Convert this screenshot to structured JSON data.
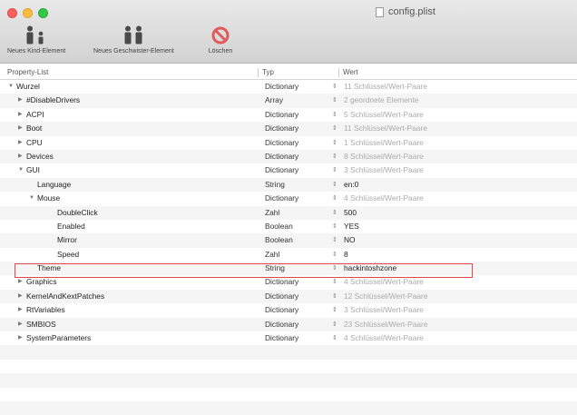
{
  "window": {
    "title": "config.plist"
  },
  "toolbar": {
    "new_child": "Neues Kind-Element",
    "new_sibling": "Neues Geschwister-Element",
    "delete": "Löschen"
  },
  "columns": {
    "key": "Property-List",
    "type": "Typ",
    "value": "Wert"
  },
  "rows": [
    {
      "key": "Wurzel",
      "level": 0,
      "expander": "expanded",
      "type": "Dictionary",
      "value": "11 Schlüssel/Wert-Paare",
      "value_style": "dim"
    },
    {
      "key": "#DisableDrivers",
      "level": 1,
      "expander": "collapsed",
      "type": "Array",
      "value": "2 geordnete Elemente",
      "value_style": "dim"
    },
    {
      "key": "ACPI",
      "level": 1,
      "expander": "collapsed",
      "type": "Dictionary",
      "value": "5 Schlüssel/Wert-Paare",
      "value_style": "dim"
    },
    {
      "key": "Boot",
      "level": 1,
      "expander": "collapsed",
      "type": "Dictionary",
      "value": "11 Schlüssel/Wert-Paare",
      "value_style": "dim"
    },
    {
      "key": "CPU",
      "level": 1,
      "expander": "collapsed",
      "type": "Dictionary",
      "value": "1 Schlüssel/Wert-Paare",
      "value_style": "dim"
    },
    {
      "key": "Devices",
      "level": 1,
      "expander": "collapsed",
      "type": "Dictionary",
      "value": "8 Schlüssel/Wert-Paare",
      "value_style": "dim"
    },
    {
      "key": "GUI",
      "level": 1,
      "expander": "expanded",
      "type": "Dictionary",
      "value": "3 Schlüssel/Wert-Paare",
      "value_style": "dim"
    },
    {
      "key": "Language",
      "level": 2,
      "expander": "none",
      "type": "String",
      "value": "en:0",
      "value_style": "dark"
    },
    {
      "key": "Mouse",
      "level": 2,
      "expander": "expanded",
      "type": "Dictionary",
      "value": "4 Schlüssel/Wert-Paare",
      "value_style": "dim"
    },
    {
      "key": "DoubleClick",
      "level": 3,
      "expander": "none",
      "type": "Zahl",
      "value": "500",
      "value_style": "dark"
    },
    {
      "key": "Enabled",
      "level": 3,
      "expander": "none",
      "type": "Boolean",
      "value": "YES",
      "value_style": "dark"
    },
    {
      "key": "Mirror",
      "level": 3,
      "expander": "none",
      "type": "Boolean",
      "value": "NO",
      "value_style": "dark"
    },
    {
      "key": "Speed",
      "level": 3,
      "expander": "none",
      "type": "Zahl",
      "value": "8",
      "value_style": "dark"
    },
    {
      "key": "Theme",
      "level": 2,
      "expander": "none",
      "type": "String",
      "value": "hackintoshzone",
      "value_style": "dark"
    },
    {
      "key": "Graphics",
      "level": 1,
      "expander": "collapsed",
      "type": "Dictionary",
      "value": "4 Schlüssel/Wert-Paare",
      "value_style": "dim"
    },
    {
      "key": "KernelAndKextPatches",
      "level": 1,
      "expander": "collapsed",
      "type": "Dictionary",
      "value": "12 Schlüssel/Wert-Paare",
      "value_style": "dim"
    },
    {
      "key": "RtVariables",
      "level": 1,
      "expander": "collapsed",
      "type": "Dictionary",
      "value": "3 Schlüssel/Wert-Paare",
      "value_style": "dim"
    },
    {
      "key": "SMBIOS",
      "level": 1,
      "expander": "collapsed",
      "type": "Dictionary",
      "value": "23 Schlüssel/Wert-Paare",
      "value_style": "dim"
    },
    {
      "key": "SystemParameters",
      "level": 1,
      "expander": "collapsed",
      "type": "Dictionary",
      "value": "4 Schlüssel/Wert-Paare",
      "value_style": "dim"
    }
  ],
  "colors": {
    "highlight_border": "#e0474c",
    "delete_icon": "#e05a5a"
  }
}
